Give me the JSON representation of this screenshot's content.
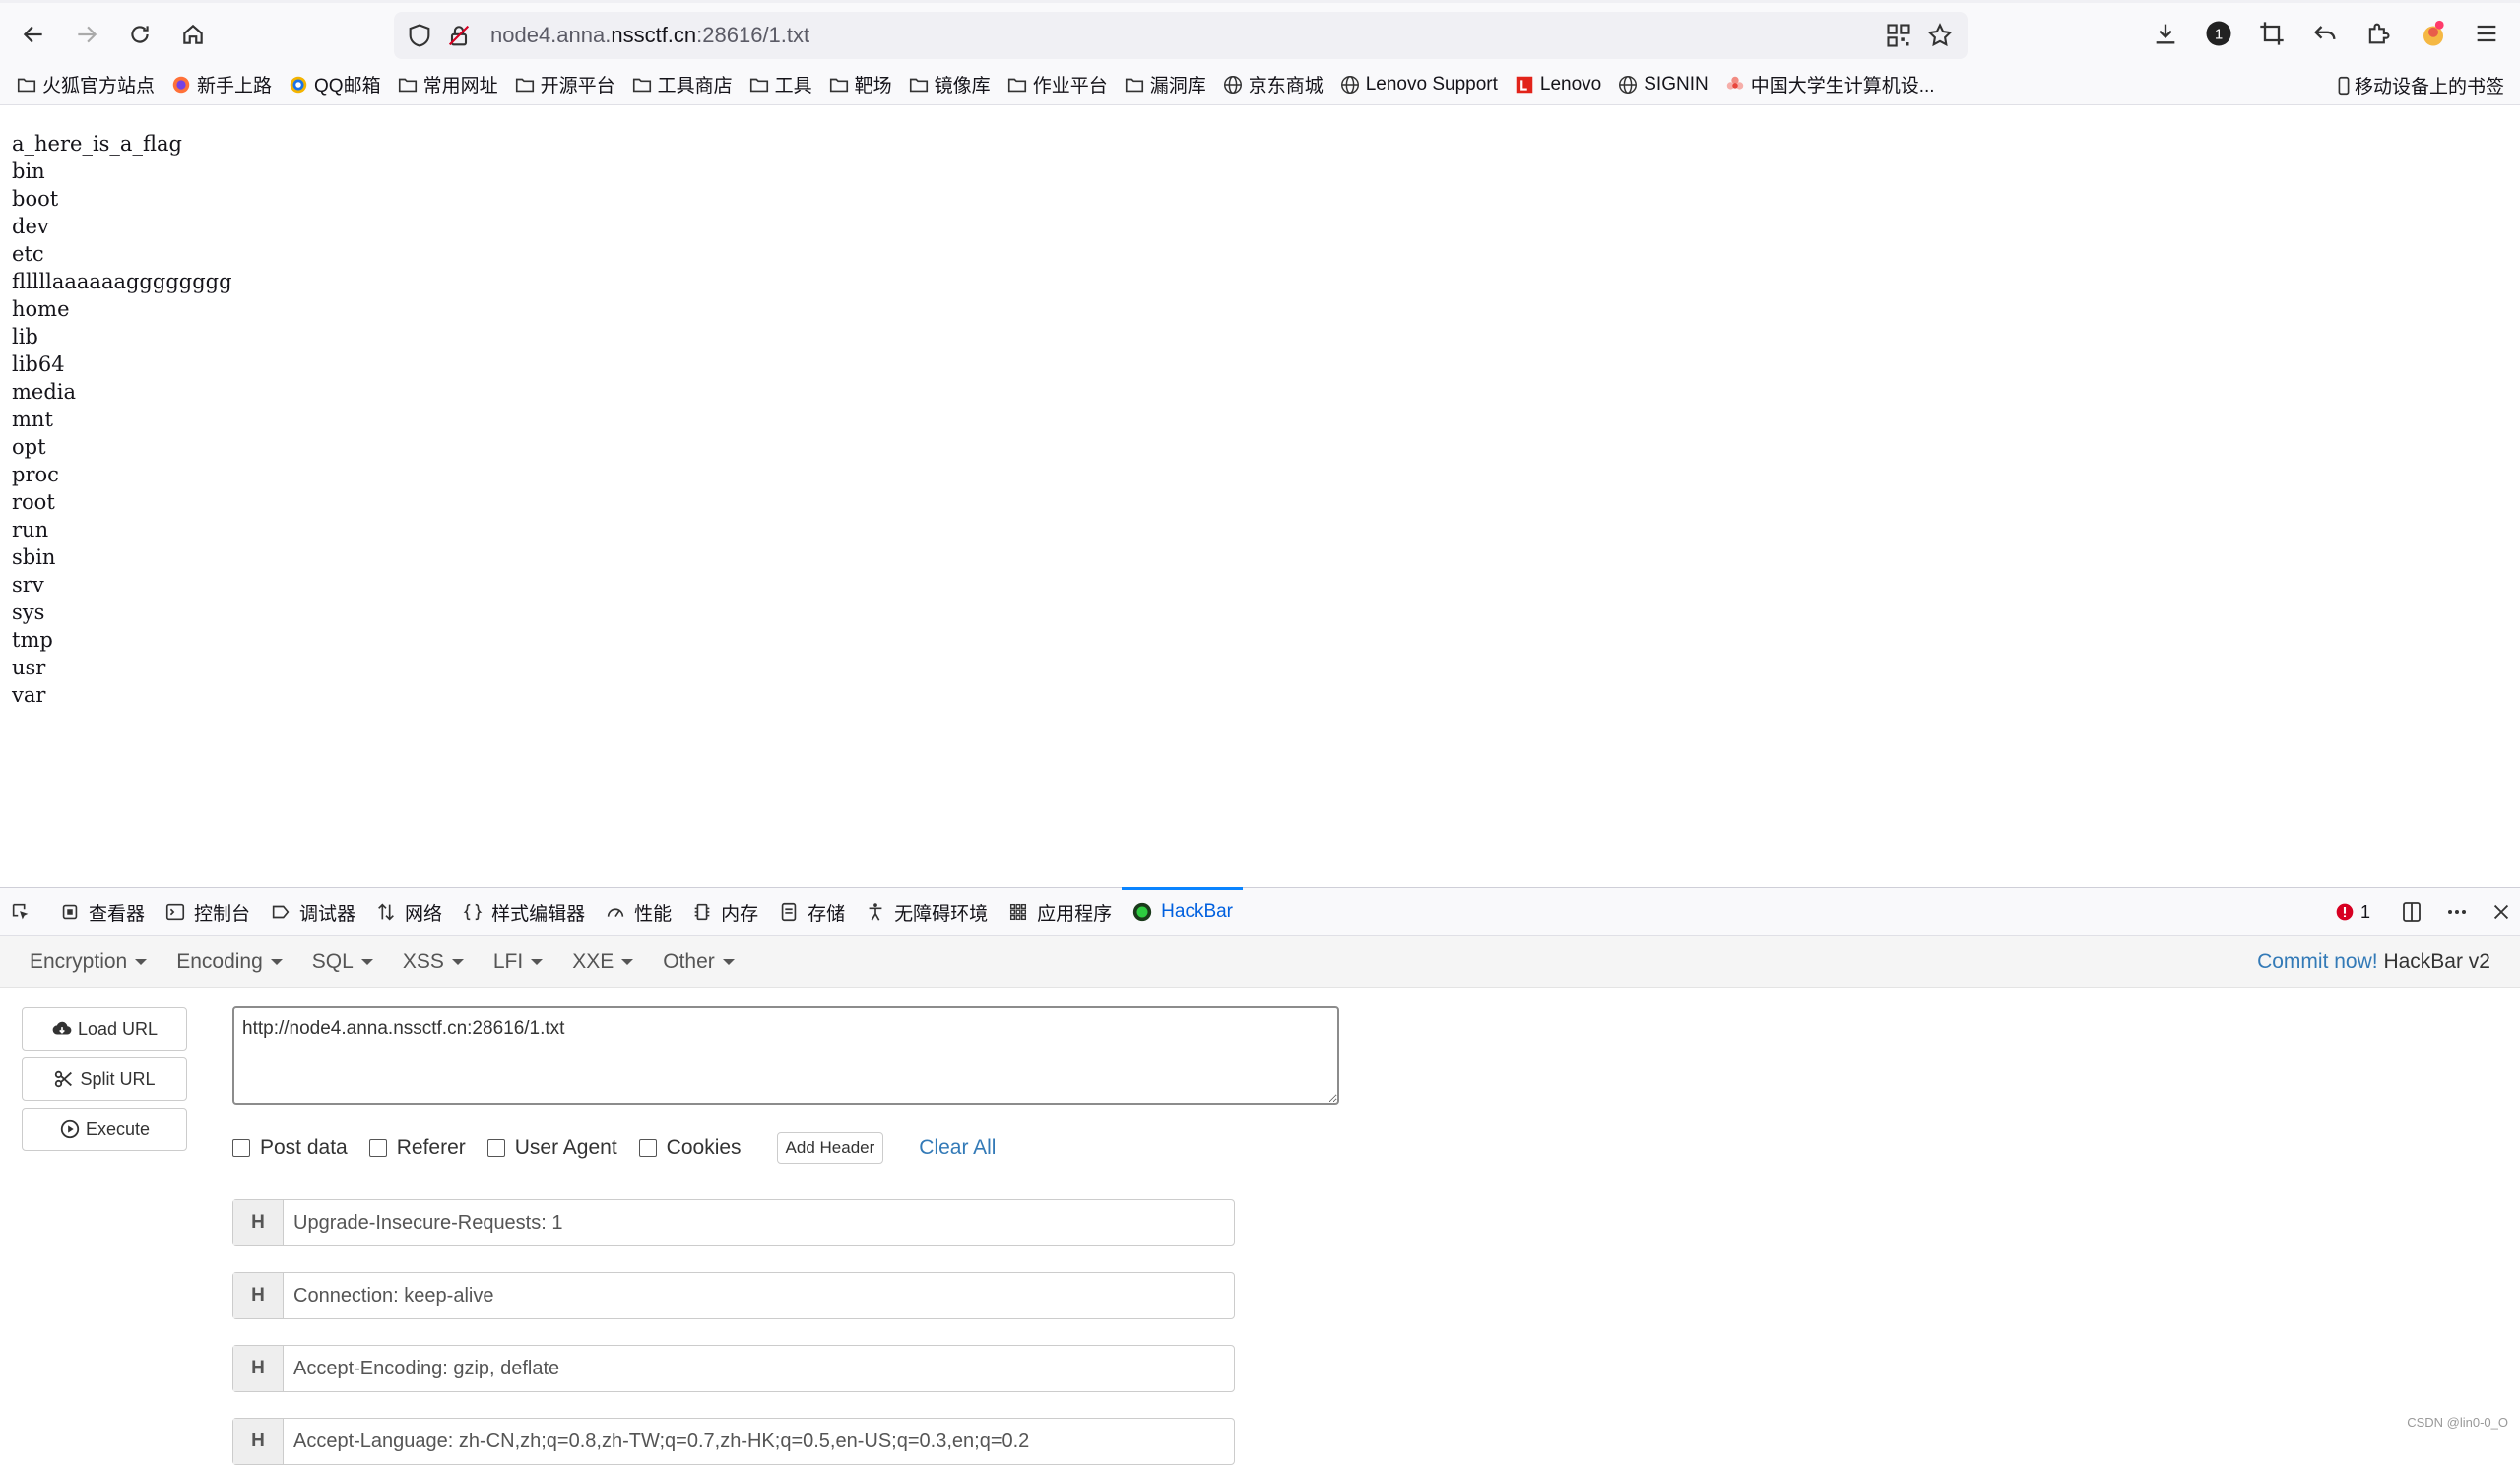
{
  "browser": {
    "url_prefix": "node4.anna.",
    "url_domain": "nssctf.cn",
    "url_suffix": ":28616/1.txt",
    "bookmarks": [
      {
        "label": "火狐官方站点",
        "icon": "folder-icon"
      },
      {
        "label": "新手上路",
        "icon": "firefox-icon"
      },
      {
        "label": "QQ邮箱",
        "icon": "qq-mail-icon"
      },
      {
        "label": "常用网址",
        "icon": "folder-icon"
      },
      {
        "label": "开源平台",
        "icon": "folder-icon"
      },
      {
        "label": "工具商店",
        "icon": "folder-icon"
      },
      {
        "label": "工具",
        "icon": "folder-icon"
      },
      {
        "label": "靶场",
        "icon": "folder-icon"
      },
      {
        "label": "镜像库",
        "icon": "folder-icon"
      },
      {
        "label": "作业平台",
        "icon": "folder-icon"
      },
      {
        "label": "漏洞库",
        "icon": "folder-icon"
      },
      {
        "label": "京东商城",
        "icon": "globe-icon"
      },
      {
        "label": "Lenovo Support",
        "icon": "globe-icon"
      },
      {
        "label": "Lenovo",
        "icon": "lenovo-icon"
      },
      {
        "label": "SIGNIN",
        "icon": "globe-icon"
      },
      {
        "label": "中国大学生计算机设...",
        "icon": "flower-icon"
      }
    ],
    "mobile_bookmarks": "移动设备上的书签",
    "notification_count": "1"
  },
  "content": {
    "lines": [
      "a_here_is_a_flag",
      "bin",
      "boot",
      "dev",
      "etc",
      "flllllaaaaaagggggggg",
      "home",
      "lib",
      "lib64",
      "media",
      "mnt",
      "opt",
      "proc",
      "root",
      "run",
      "sbin",
      "srv",
      "sys",
      "tmp",
      "usr",
      "var"
    ]
  },
  "devtools": {
    "tabs": [
      {
        "label": "查看器",
        "icon": "inspector-icon"
      },
      {
        "label": "控制台",
        "icon": "console-icon"
      },
      {
        "label": "调试器",
        "icon": "debugger-icon"
      },
      {
        "label": "网络",
        "icon": "network-icon"
      },
      {
        "label": "样式编辑器",
        "icon": "style-editor-icon"
      },
      {
        "label": "性能",
        "icon": "performance-icon"
      },
      {
        "label": "内存",
        "icon": "memory-icon"
      },
      {
        "label": "存储",
        "icon": "storage-icon"
      },
      {
        "label": "无障碍环境",
        "icon": "accessibility-icon"
      },
      {
        "label": "应用程序",
        "icon": "application-icon"
      },
      {
        "label": "HackBar",
        "icon": "hackbar-icon",
        "active": true
      }
    ],
    "error_count": "1"
  },
  "hackbar": {
    "menu": [
      "Encryption",
      "Encoding",
      "SQL",
      "XSS",
      "LFI",
      "XXE",
      "Other"
    ],
    "commit_link": "Commit now!",
    "version": "HackBar v2",
    "buttons": {
      "load_url": "Load URL",
      "split_url": "Split URL",
      "execute": "Execute"
    },
    "url_value": "http://node4.anna.nssctf.cn:28616/1.txt",
    "options": {
      "post_data": "Post data",
      "referer": "Referer",
      "user_agent": "User Agent",
      "cookies": "Cookies"
    },
    "add_header": "Add Header",
    "clear_all": "Clear All",
    "header_badge": "H",
    "headers": [
      "Upgrade-Insecure-Requests: 1",
      "Connection: keep-alive",
      "Accept-Encoding: gzip, deflate",
      "Accept-Language: zh-CN,zh;q=0.8,zh-TW;q=0.7,zh-HK;q=0.5,en-US;q=0.3,en;q=0.2"
    ]
  },
  "watermark": "CSDN @lin0-0_O"
}
